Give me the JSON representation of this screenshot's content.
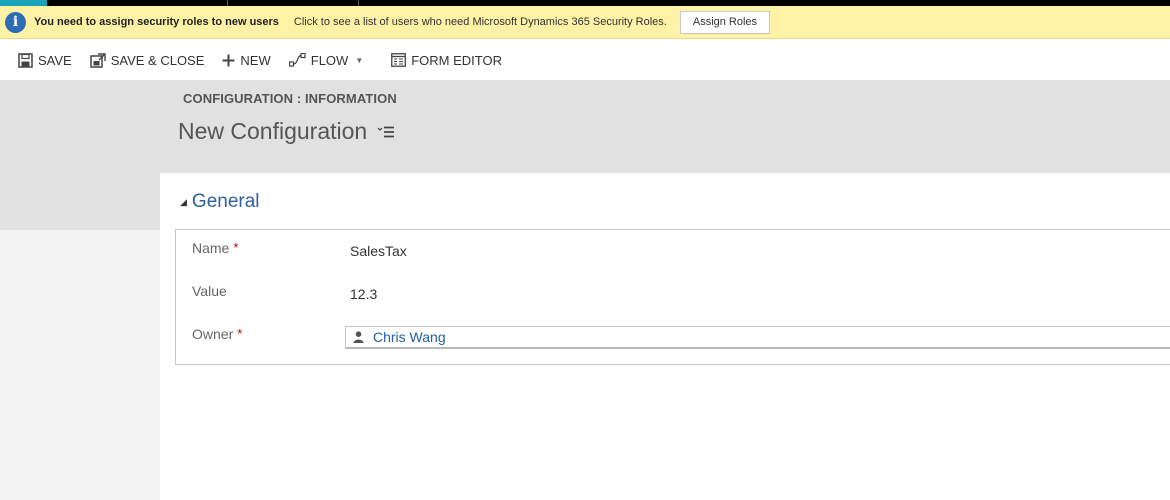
{
  "notification": {
    "message": "You need to assign security roles to new users",
    "detail": "Click to see a list of users who need Microsoft Dynamics 365 Security Roles.",
    "button_label": "Assign Roles"
  },
  "toolbar": {
    "save": "SAVE",
    "save_close": "SAVE & CLOSE",
    "new": "NEW",
    "flow": "FLOW",
    "form_editor": "FORM EDITOR"
  },
  "header": {
    "entity": "CONFIGURATION : INFORMATION",
    "record_name": "New Configuration"
  },
  "section": {
    "title": "General"
  },
  "fields": {
    "name": {
      "label": "Name",
      "required": "*",
      "value": "SalesTax"
    },
    "value": {
      "label": "Value",
      "value": "12.3"
    },
    "owner": {
      "label": "Owner",
      "required": "*",
      "value": "Chris Wang"
    }
  },
  "colors": {
    "notification_bg": "#fdf2a6",
    "header_bg": "#e1e1e1",
    "section_title": "#2e5f9e",
    "link": "#1f5ea8",
    "required": "#c00000",
    "accent": "#17a2b8"
  },
  "icons": [
    "info-icon",
    "save-icon",
    "save-close-icon",
    "plus-icon",
    "flow-icon",
    "chevron-down-icon",
    "form-editor-icon",
    "record-menu-icon",
    "collapse-triangle-icon",
    "user-icon"
  ]
}
